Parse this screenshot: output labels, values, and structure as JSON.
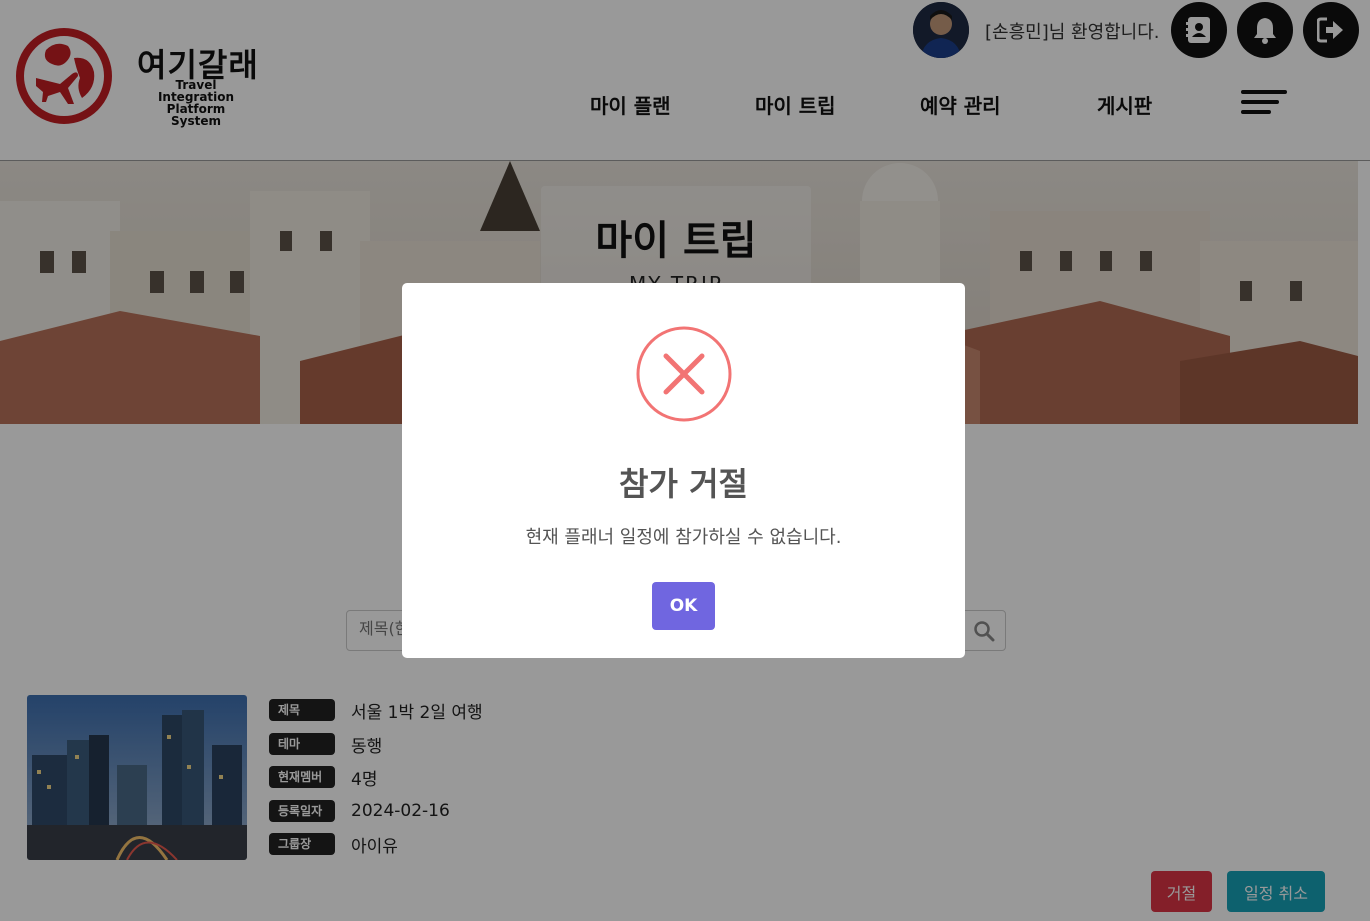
{
  "header": {
    "brand_name": "여기갈래",
    "brand_sub_line1": "Travel Integration",
    "brand_sub_line2": "Platform System",
    "welcome": "[손흥민]님 환영합니다.",
    "icons": [
      "contacts-icon",
      "bell-icon",
      "logout-icon"
    ],
    "nav": [
      "마이 플랜",
      "마이 트립",
      "예약 관리",
      "게시판"
    ]
  },
  "hero": {
    "title": "마이 트립",
    "subtitle": "MY TRIP"
  },
  "search": {
    "placeholder": "제목(한"
  },
  "trip": {
    "rows": [
      {
        "label": "제목",
        "value": "서울 1박 2일 여행"
      },
      {
        "label": "테마",
        "value": "동행"
      },
      {
        "label": "현재멤버",
        "value": "4명"
      },
      {
        "label": "등록일자",
        "value": "2024-02-16"
      },
      {
        "label": "그룹장",
        "value": "아이유"
      }
    ],
    "reject_label": "거절",
    "cancel_label": "일정 취소"
  },
  "modal": {
    "title": "참가 거절",
    "text": "현재 플래너 일정에 참가하실 수 없습니다.",
    "ok_label": "OK"
  },
  "colors": {
    "brand_red": "#c41e24",
    "ok_button": "#7066e0",
    "reject_button": "#dc3545",
    "cancel_button": "#17a2b8",
    "error_icon": "#f27474"
  }
}
